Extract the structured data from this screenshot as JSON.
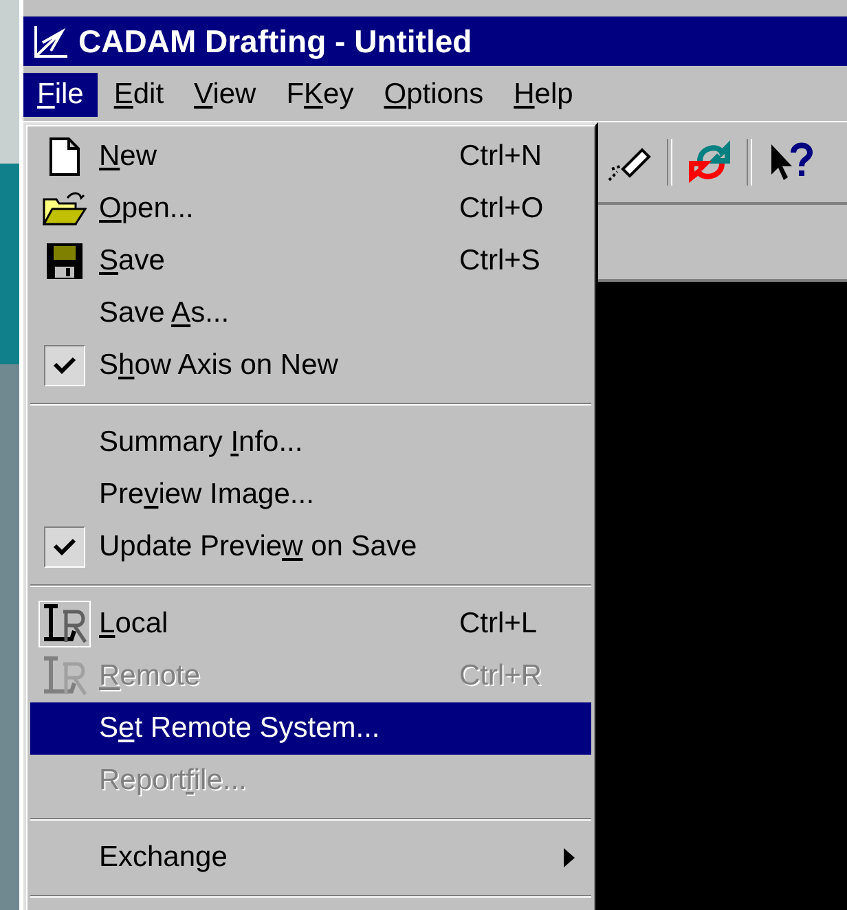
{
  "window": {
    "title": "CADAM Drafting - Untitled"
  },
  "menubar": [
    {
      "label": {
        "key": "F",
        "post": "ile"
      },
      "selected": true
    },
    {
      "label": {
        "key": "E",
        "post": "dit"
      },
      "selected": false
    },
    {
      "label": {
        "key": "V",
        "post": "iew"
      },
      "selected": false
    },
    {
      "label": {
        "pre": "F",
        "key": "K",
        "post": "ey"
      },
      "selected": false
    },
    {
      "label": {
        "key": "O",
        "post": "ptions"
      },
      "selected": false
    },
    {
      "label": {
        "key": "H",
        "post": "elp"
      },
      "selected": false
    }
  ],
  "toolbar": [
    {
      "kind": "pen"
    },
    {
      "kind": "separator"
    },
    {
      "kind": "refresh"
    },
    {
      "kind": "separator"
    },
    {
      "kind": "help"
    }
  ],
  "file_menu": [
    {
      "kind": "page",
      "label": {
        "key": "N",
        "post": "ew"
      },
      "shortcut": "Ctrl+N",
      "disabled": false,
      "selected": false
    },
    {
      "kind": "folder",
      "label": {
        "key": "O",
        "post": "pen..."
      },
      "shortcut": "Ctrl+O",
      "disabled": false,
      "selected": false
    },
    {
      "kind": "floppy",
      "label": {
        "key": "S",
        "post": "ave"
      },
      "shortcut": "Ctrl+S",
      "disabled": false,
      "selected": false
    },
    {
      "kind": "item",
      "label": {
        "pre": "Save ",
        "key": "A",
        "post": "s..."
      },
      "disabled": false,
      "selected": false
    },
    {
      "kind": "check",
      "checked": true,
      "label": {
        "pre": "S",
        "key": "h",
        "post": "ow Axis on New"
      },
      "disabled": false,
      "selected": false
    },
    {
      "kind": "separator"
    },
    {
      "kind": "item",
      "label": {
        "pre": "Summary ",
        "key": "I",
        "post": "nfo..."
      },
      "disabled": false,
      "selected": false
    },
    {
      "kind": "item",
      "label": {
        "pre": "Pre",
        "key": "v",
        "post": "iew Image..."
      },
      "disabled": false,
      "selected": false
    },
    {
      "kind": "check",
      "checked": true,
      "label": {
        "pre": "Update Previe",
        "key": "w",
        "post": " on Save"
      },
      "disabled": false,
      "selected": false
    },
    {
      "kind": "separator"
    },
    {
      "kind": "lr",
      "label": {
        "key": "L",
        "post": "ocal"
      },
      "shortcut": "Ctrl+L",
      "disabled": false,
      "selected": false
    },
    {
      "kind": "lr",
      "label": {
        "key": "R",
        "post": "emote"
      },
      "shortcut": "Ctrl+R",
      "disabled": true,
      "selected": false
    },
    {
      "kind": "item",
      "label": {
        "pre": "S",
        "key": "e",
        "post": "t Remote System..."
      },
      "disabled": false,
      "selected": true
    },
    {
      "kind": "item",
      "label": {
        "pre": "Report",
        "key": "f",
        "post": "ile..."
      },
      "disabled": true,
      "selected": false
    },
    {
      "kind": "separator"
    },
    {
      "kind": "item",
      "label": {
        "post": "Exchange"
      },
      "submenu": true,
      "disabled": false,
      "selected": false
    },
    {
      "kind": "separator"
    }
  ]
}
